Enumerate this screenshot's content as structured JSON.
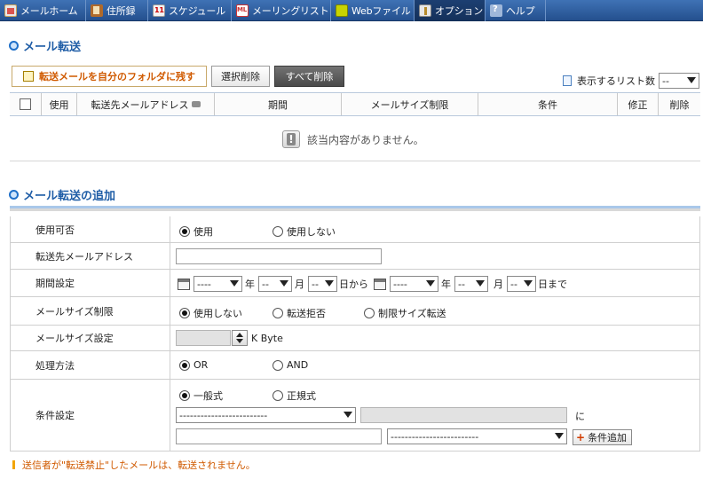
{
  "tabs": [
    {
      "label": "メールホーム",
      "icon": "home-icon"
    },
    {
      "label": "住所録",
      "icon": "address-book-icon"
    },
    {
      "label": "スケジュール",
      "icon": "calendar-icon"
    },
    {
      "label": "メーリングリスト",
      "icon": "mailing-list-icon"
    },
    {
      "label": "Webファイル",
      "icon": "web-file-icon"
    },
    {
      "label": "オプション",
      "icon": "option-icon",
      "active": true
    },
    {
      "label": "ヘルプ",
      "icon": "help-icon"
    }
  ],
  "forward_section": {
    "title": "メール転送",
    "keep_copy_label": "転送メールを自分のフォルダに残す",
    "delete_selected_label": "選択削除",
    "delete_all_label": "すべて削除",
    "list_count_label": "表示するリスト数",
    "list_count_value": "--",
    "columns": [
      "使用",
      "転送先メールアドレス",
      "期間",
      "メールサイズ制限",
      "条件",
      "修正",
      "削除"
    ],
    "empty_message": "該当内容がありません。"
  },
  "add_section": {
    "title": "メール転送の追加",
    "usage": {
      "label": "使用可否",
      "options": [
        "使用",
        "使用しない"
      ],
      "selected": "使用"
    },
    "address": {
      "label": "転送先メールアドレス",
      "value": ""
    },
    "period": {
      "label": "期間設定",
      "from_year": "----",
      "year_unit": "年",
      "from_month": "--",
      "month_unit": "月",
      "from_day": "--",
      "from_suffix": "日から",
      "to_year": "----",
      "to_month": "--",
      "to_day": "--",
      "to_suffix": "日まで"
    },
    "size_limit": {
      "label": "メールサイズ制限",
      "options": [
        "使用しない",
        "転送拒否",
        "制限サイズ転送"
      ],
      "selected": "使用しない"
    },
    "size_setting": {
      "label": "メールサイズ設定",
      "value": "",
      "unit": "K Byte"
    },
    "process": {
      "label": "処理方法",
      "options": [
        "OR",
        "AND"
      ],
      "selected": "OR"
    },
    "condition": {
      "label": "条件設定",
      "options": [
        "一般式",
        "正規式"
      ],
      "selected": "一般式",
      "field_select": "-------------------------",
      "particle": "に",
      "match_select": "-------------------------",
      "add_label": "条件追加"
    }
  },
  "note": "送信者が\"転送禁止\"したメールは、転送されません。"
}
